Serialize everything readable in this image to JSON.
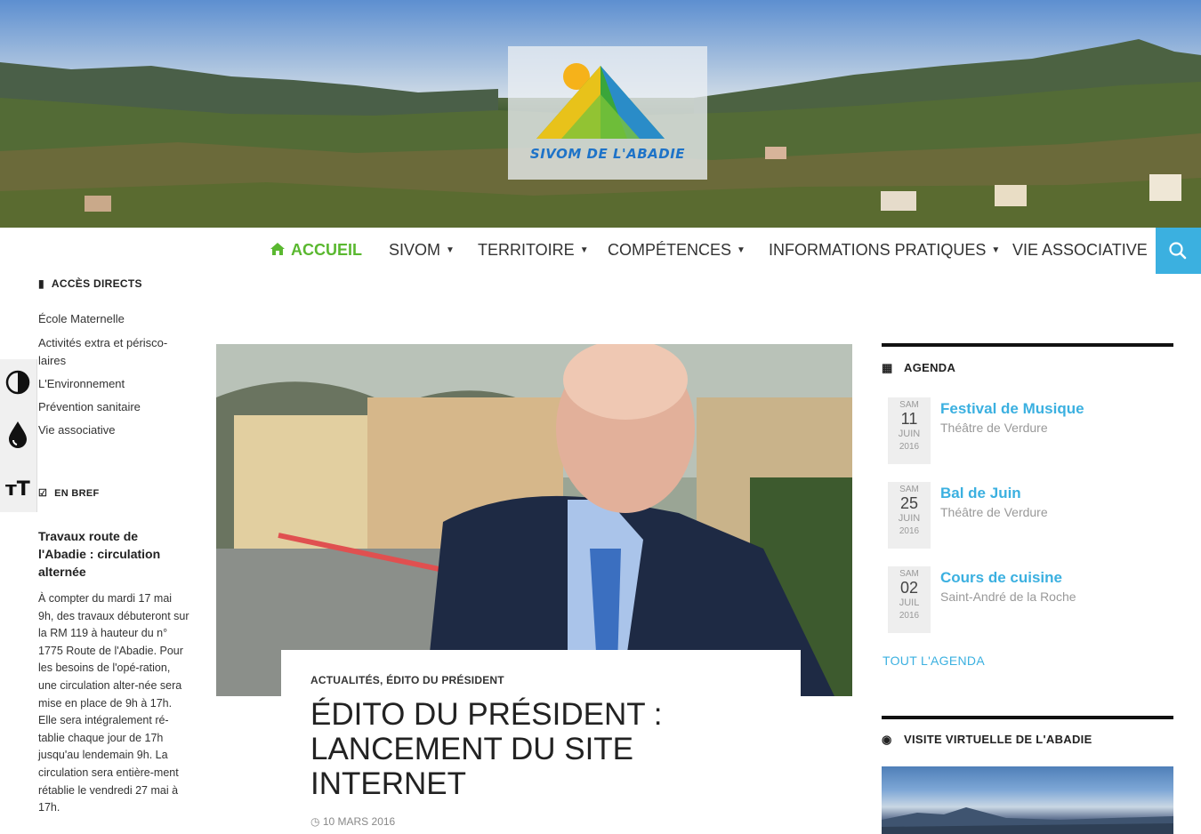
{
  "brand": {
    "logo_text": "SIVOM DE L'ABADIE",
    "accent": "#3bb0e0",
    "home_green": "#5ab830"
  },
  "nav": {
    "home": "ACCUEIL",
    "items": [
      {
        "label": "SIVOM",
        "has_dropdown": true
      },
      {
        "label": "TERRITOIRE",
        "has_dropdown": true
      },
      {
        "label": "COMPÉTENCES",
        "has_dropdown": true
      },
      {
        "label": "INFORMATIONS PRATIQUES",
        "has_dropdown": true
      },
      {
        "label": "VIE ASSOCIATIVE",
        "has_dropdown": false
      }
    ],
    "search_icon": "search-icon"
  },
  "a11y": {
    "icons": [
      "contrast-icon",
      "drop-icon",
      "text-size-icon"
    ],
    "text_size_glyph": "тT"
  },
  "sidebar": {
    "direct_title": "ACCÈS DIRECTS",
    "links": [
      "École Maternelle",
      "Activités extra et périsco-laires",
      "L'Environnement",
      "Prévention sanitaire",
      "Vie associative"
    ],
    "brief_title": "EN BREF",
    "brief_heading": "Travaux route de l'Abadie : circulation alternée",
    "brief_body": "À compter du mardi 17 mai 9h, des travaux débuteront sur la RM 119 à hauteur du n° 1775 Route de l'Abadie. Pour les besoins de l'opé-ration, une circulation alter-née sera mise en place de 9h à 17h. Elle sera intégralement ré-tablie chaque jour de 17h jusqu'au lendemain 9h. La circulation sera entière-ment rétablie le vendredi 27 mai à 17h."
  },
  "article": {
    "categories": "ACTUALITÉS, ÉDITO DU PRÉSIDENT",
    "title": "ÉDITO DU PRÉSIDENT : LANCEMENT DU SITE INTERNET",
    "date": "10 MARS 2016"
  },
  "agenda": {
    "title": "AGENDA",
    "events": [
      {
        "day": "SAM",
        "num": "11",
        "month": "JUIN",
        "year": "2016",
        "name": "Festival de Musique",
        "place": "Théâtre de Verdure"
      },
      {
        "day": "SAM",
        "num": "25",
        "month": "JUIN",
        "year": "2016",
        "name": "Bal de Juin",
        "place": "Théâtre de Verdure"
      },
      {
        "day": "SAM",
        "num": "02",
        "month": "JUIL",
        "year": "2016",
        "name": "Cours de cuisine",
        "place": "Saint-André de la Roche"
      }
    ],
    "all_link": "TOUT L'AGENDA"
  },
  "tour": {
    "title": "VISITE VIRTUELLE DE L'ABADIE"
  }
}
